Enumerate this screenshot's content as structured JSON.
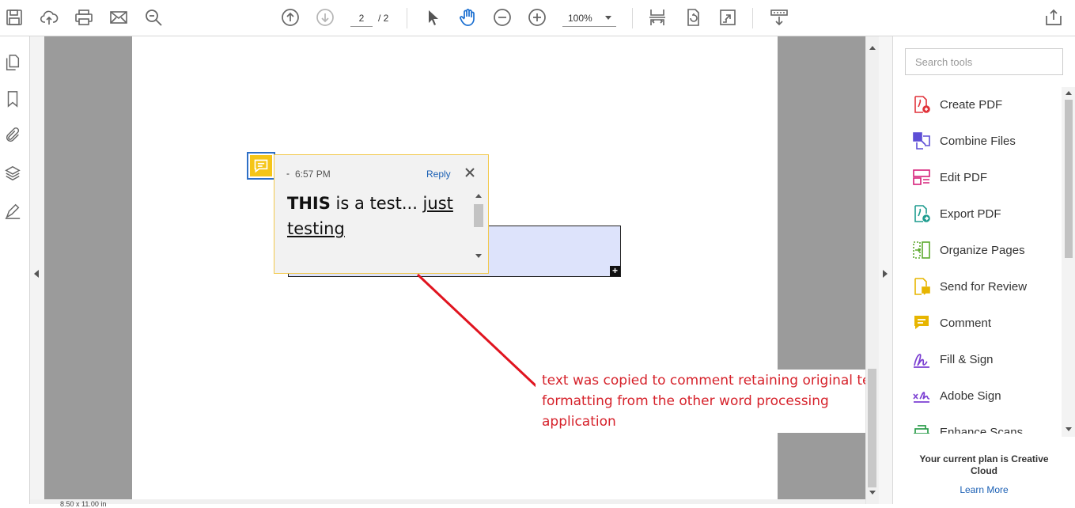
{
  "toolbar": {
    "current_page": "2",
    "page_total": "/ 2",
    "zoom": "100%",
    "buttons": [
      "save-icon",
      "upload-cloud-icon",
      "print-icon",
      "email-icon",
      "find-icon",
      "previous-page-icon",
      "next-page-icon",
      "select-cursor-icon",
      "hand-tool-icon",
      "zoom-out-icon",
      "zoom-in-icon",
      "scrolling-mode-icon",
      "rotate-view-icon",
      "full-screen-icon",
      "read-mode-icon",
      "share-icon"
    ]
  },
  "left_rail": [
    "page-thumbnails-icon",
    "bookmarks-icon",
    "attachments-icon",
    "layers-icon",
    "signatures-icon"
  ],
  "status": {
    "page_size": "8.50 x 11.00 in"
  },
  "comment": {
    "author": "-",
    "time": "6:57 PM",
    "reply_label": "Reply",
    "body_bold": "THIS",
    "body_plain": " is a test... ",
    "body_underlined_1": "just",
    "body_underlined_2": "testing"
  },
  "annotation": {
    "text": "text was copied to comment retaining original text formatting from the other word processing application",
    "color": "#d6222b"
  },
  "tools_pane": {
    "search_placeholder": "Search tools",
    "tools": [
      {
        "label": "Create PDF",
        "icon": "create-pdf-icon",
        "color": "#e1343b"
      },
      {
        "label": "Combine Files",
        "icon": "combine-files-icon",
        "color": "#5e4fd6"
      },
      {
        "label": "Edit PDF",
        "icon": "edit-pdf-icon",
        "color": "#d6207a"
      },
      {
        "label": "Export PDF",
        "icon": "export-pdf-icon",
        "color": "#1e9c8f"
      },
      {
        "label": "Organize Pages",
        "icon": "organize-pages-icon",
        "color": "#5ba82c"
      },
      {
        "label": "Send for Review",
        "icon": "send-for-review-icon",
        "color": "#e7b500"
      },
      {
        "label": "Comment",
        "icon": "comment-icon",
        "color": "#e7b500"
      },
      {
        "label": "Fill & Sign",
        "icon": "fill-sign-icon",
        "color": "#7b3fd2"
      },
      {
        "label": "Adobe Sign",
        "icon": "adobe-sign-icon",
        "color": "#7b3fd2"
      },
      {
        "label": "Enhance Scans",
        "icon": "enhance-scans-icon",
        "color": "#2c9d4b"
      }
    ],
    "plan_text": "Your current plan is Creative Cloud",
    "learn_more": "Learn More"
  }
}
